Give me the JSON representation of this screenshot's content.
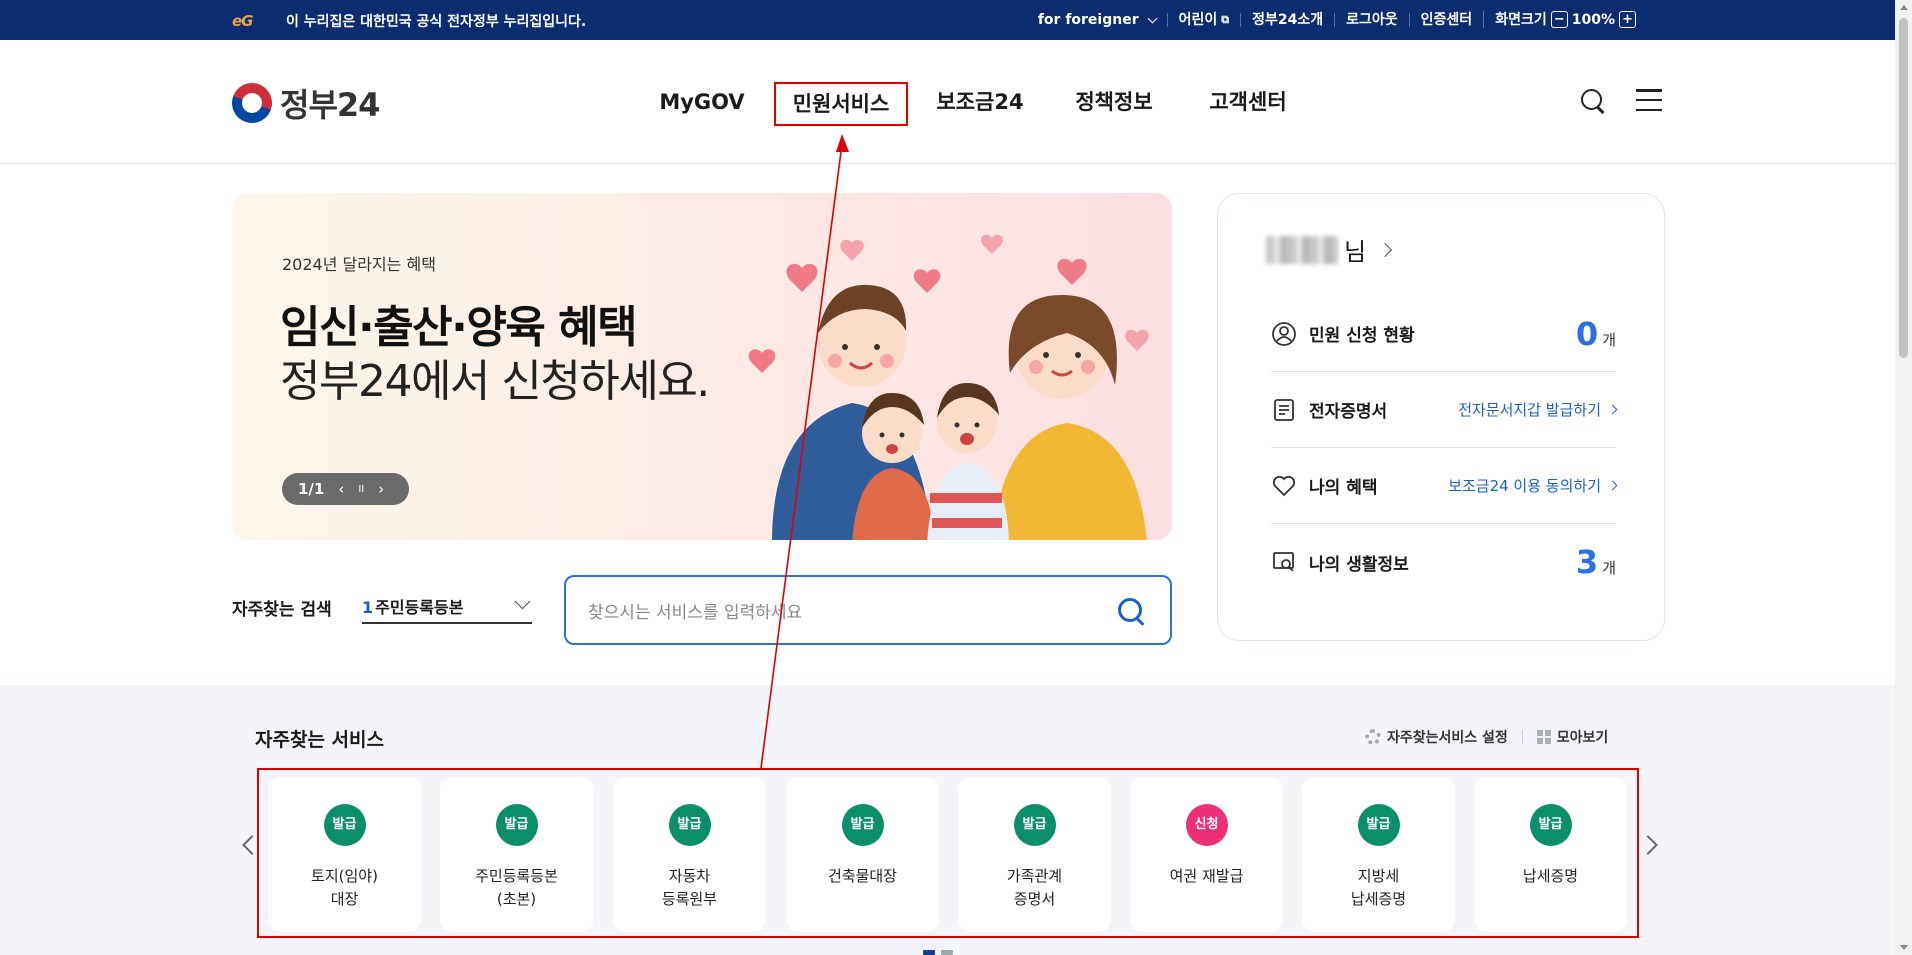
{
  "topbar": {
    "notice": "이 누리집은 대한민국 공식 전자정부 누리집입니다.",
    "logo_mark": "eG",
    "menu": [
      "for foreigner",
      "어린이",
      "정부24소개",
      "로그아웃",
      "인증센터",
      "화면크기"
    ],
    "zoom_minus": "−",
    "zoom_value": "100%",
    "zoom_plus": "+"
  },
  "header": {
    "logo_text": "정부24",
    "nav": [
      "MyGOV",
      "민원서비스",
      "보조금24",
      "정책정보",
      "고객센터"
    ],
    "highlighted_nav": "민원서비스"
  },
  "banner": {
    "kicker": "2024년 달라지는 혜택",
    "headline": "임신·출산·양육 혜택",
    "subline": "정부24에서 신청하세요.",
    "pager_text": "1/1",
    "pause_glyph": "II"
  },
  "search": {
    "label": "자주찾는 검색",
    "select_rank": "1",
    "select_value": "주민등록등본",
    "placeholder": "찾으시는 서비스를 입력하세요"
  },
  "user_card": {
    "name_suffix": "님",
    "rows": [
      {
        "label": "민원 신청 현황",
        "count": "0",
        "unit": "개"
      },
      {
        "label": "전자증명서",
        "link": "전자문서지갑 발급하기"
      },
      {
        "label": "나의 혜택",
        "link": "보조금24 이용 동의하기"
      },
      {
        "label": "나의 생활정보",
        "count": "3",
        "unit": "개"
      }
    ]
  },
  "services": {
    "title": "자주찾는 서비스",
    "settings_link": "자주찾는서비스 설정",
    "view_all_link": "모아보기",
    "items": [
      {
        "badge": "발급",
        "name": "토지(임야)\n대장",
        "badge_color": "#0a8f6a"
      },
      {
        "badge": "발급",
        "name": "주민등록등본\n(초본)",
        "badge_color": "#0a8f6a"
      },
      {
        "badge": "발급",
        "name": "자동차\n등록원부",
        "badge_color": "#0a8f6a"
      },
      {
        "badge": "발급",
        "name": "건축물대장",
        "badge_color": "#0a8f6a"
      },
      {
        "badge": "발급",
        "name": "가족관계\n증명서",
        "badge_color": "#0a8f6a"
      },
      {
        "badge": "신청",
        "name": "여권 재발급",
        "badge_color": "#ee2f78"
      },
      {
        "badge": "발급",
        "name": "지방세\n납세증명",
        "badge_color": "#0a8f6a"
      },
      {
        "badge": "발급",
        "name": "납세증명",
        "badge_color": "#0a8f6a"
      }
    ]
  },
  "colors": {
    "topbar": "#0b2c6e",
    "accent": "#1a5fd0",
    "annotation": "#e00000"
  }
}
